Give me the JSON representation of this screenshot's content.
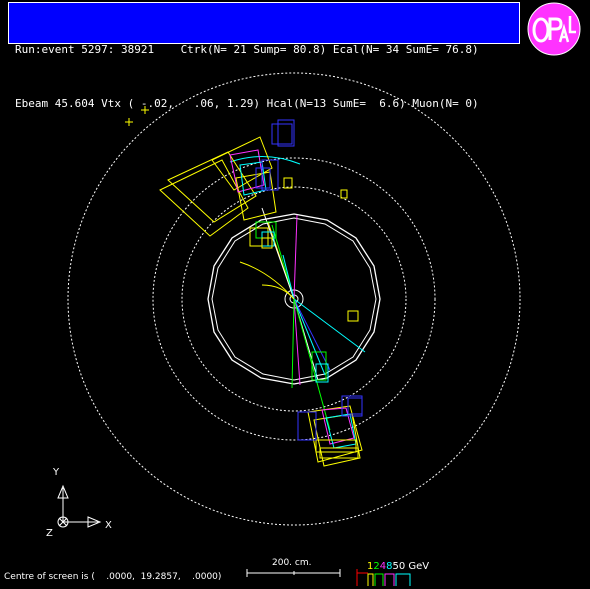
{
  "header": {
    "line1": "Run:event 5297: 38921    Ctrk(N= 21 Sump= 80.8) Ecal(N= 34 SumE= 76.8)",
    "line2": "Ebeam 45.604 Vtx ( -.02,   .06, 1.29) Hcal(N=13 SumE=  6.6) Muon(N= 0)"
  },
  "logo": {
    "text": "OPAL",
    "fill": "#ff33ff",
    "letter_color": "#ffffff"
  },
  "axes": {
    "y": "Y",
    "z": "Z",
    "x": "X"
  },
  "scale": {
    "label": "200. cm."
  },
  "energy_scale": {
    "items": [
      {
        "text": "1",
        "color": "#ffff00"
      },
      {
        "text": "2",
        "color": "#00ff00"
      },
      {
        "text": "4",
        "color": "#ff33ff"
      },
      {
        "text": "8",
        "color": "#00ffff"
      },
      {
        "text": "50 GeV",
        "color": "#ffffff"
      }
    ]
  },
  "footer": {
    "text": "Centre of screen is (    .0000,  19.2857,    .0000)"
  },
  "colors": {
    "background": "#000000",
    "header_bg": "#0000ff",
    "track_yellow": "#ffff00",
    "track_green": "#00ff00",
    "track_magenta": "#ff33ff",
    "track_cyan": "#00ffff",
    "muon_blue": "#3333ff",
    "detector_white": "#ffffff"
  }
}
